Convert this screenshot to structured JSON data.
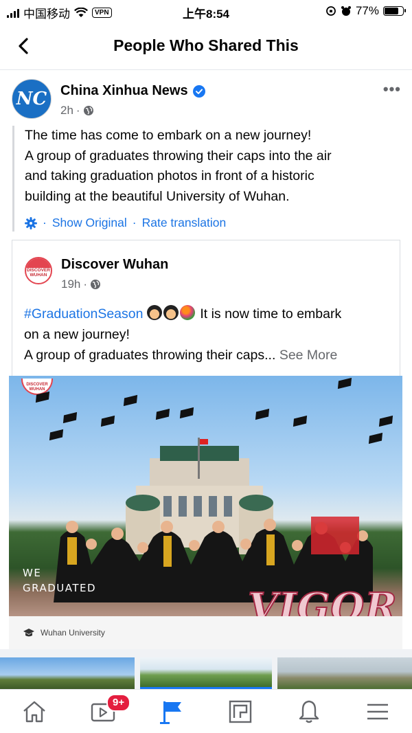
{
  "status_bar": {
    "carrier": "中国移动",
    "vpn": "VPN",
    "time": "上午8:54",
    "battery": "77%"
  },
  "nav": {
    "title": "People Who Shared This"
  },
  "post": {
    "author": "China Xinhua News",
    "avatar_text": "NC",
    "time": "2h",
    "lines": [
      "The time has come to embark on a new journey!",
      "A group of graduates throwing their caps into the air",
      "and taking graduation photos in front of a historic",
      "building at the beautiful University of Wuhan."
    ],
    "show_original": "Show Original",
    "rate_translation": "Rate translation"
  },
  "shared": {
    "author": "Discover Wuhan",
    "avatar_text": "DISCOVER WUHAN",
    "time": "19h",
    "hashtag": "#GraduationSeason",
    "line1_rest": "It is now time to embark",
    "line2": "on a new journey!",
    "line3": "A group of graduates throwing their caps...",
    "see_more": "See More"
  },
  "photo": {
    "watermark": "DISCOVER WUHAN",
    "overlay_line1": "WE",
    "overlay_line2": "GRADUATED",
    "vigor": "VIGOR",
    "caption": "Wuhan University"
  },
  "tabbar": {
    "badge": "9+",
    "tabs": [
      "home-icon",
      "video-icon",
      "pages-icon",
      "marketplace-icon",
      "notifications-icon",
      "menu-icon"
    ]
  },
  "colors": {
    "accent": "#1b74e4",
    "badge": "#e41e3f",
    "muted": "#65676b"
  }
}
